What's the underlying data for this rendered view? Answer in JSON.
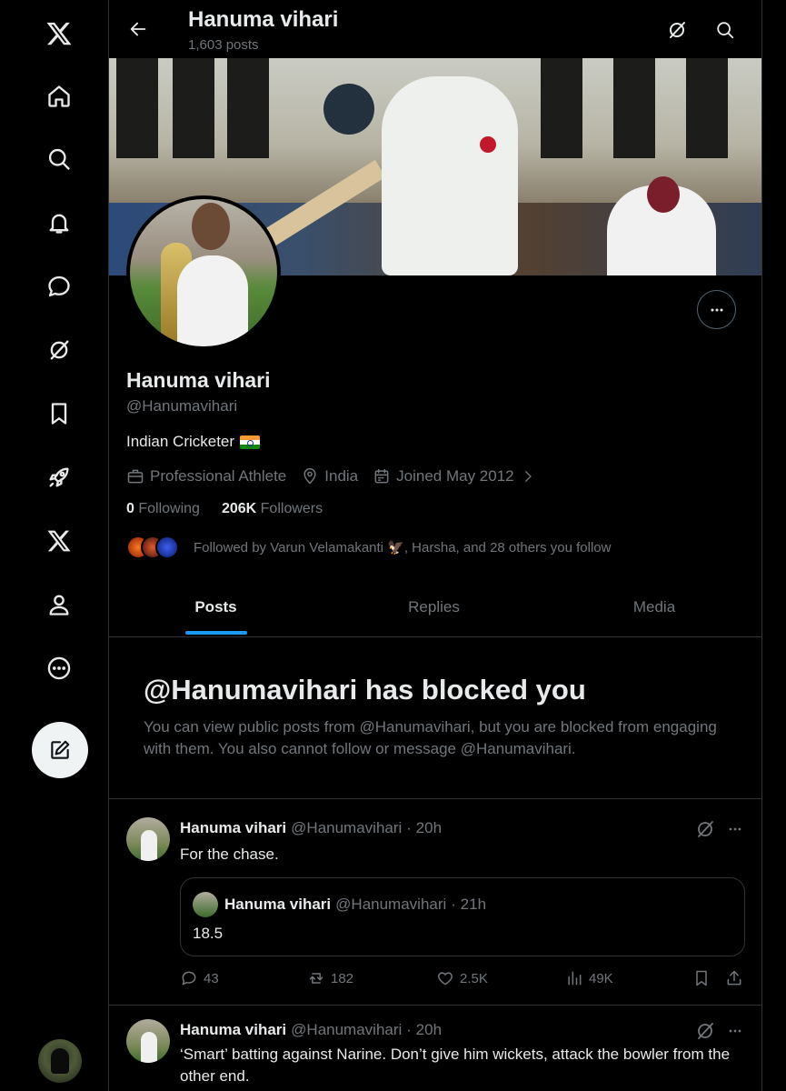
{
  "nav": {
    "items": [
      {
        "name": "x-logo-icon"
      },
      {
        "name": "home-icon"
      },
      {
        "name": "search-icon"
      },
      {
        "name": "notifications-icon"
      },
      {
        "name": "messages-icon"
      },
      {
        "name": "grok-icon"
      },
      {
        "name": "bookmarks-icon"
      },
      {
        "name": "rocket-icon"
      },
      {
        "name": "premium-x-icon"
      },
      {
        "name": "profile-icon"
      },
      {
        "name": "more-icon"
      }
    ],
    "compose_icon": "compose-icon"
  },
  "topbar": {
    "title": "Hanuma vihari",
    "posts_count": "1,603 posts"
  },
  "profile": {
    "name": "Hanuma vihari",
    "handle": "@Hanumavihari",
    "bio": "Indian Cricketer",
    "category": "Professional Athlete",
    "location": "India",
    "joined": "Joined May 2012",
    "following_count": "0",
    "following_label": "Following",
    "followers_count": "206K",
    "followers_label": "Followers",
    "followed_by": "Followed by Varun Velamakanti 🦅, Harsha, and 28 others you follow"
  },
  "tabs": [
    {
      "label": "Posts",
      "active": true
    },
    {
      "label": "Replies",
      "active": false
    },
    {
      "label": "Media",
      "active": false
    }
  ],
  "blocked": {
    "title": "@Hanumavihari has blocked you",
    "description": "You can view public posts from @Hanumavihari, but you are blocked from engaging with them. You also cannot follow or message @Hanumavihari."
  },
  "posts": [
    {
      "name": "Hanuma vihari",
      "handle": "@Hanumavihari",
      "time": "· 20h",
      "text": "For the chase.",
      "quote": {
        "name": "Hanuma vihari",
        "handle": "@Hanumavihari",
        "time": "· 21h",
        "text": "18.5"
      },
      "replies": "43",
      "reposts": "182",
      "likes": "2.5K",
      "views": "49K"
    },
    {
      "name": "Hanuma vihari",
      "handle": "@Hanumavihari",
      "time": "· 20h",
      "text": "‘Smart’ batting against Narine. Don’t give him wickets, attack the bowler from the other end."
    }
  ],
  "colors": {
    "background": "#000000",
    "text": "#e7e9ea",
    "muted": "#71767b",
    "accent": "#1d9bf0",
    "border": "#2f3336"
  }
}
